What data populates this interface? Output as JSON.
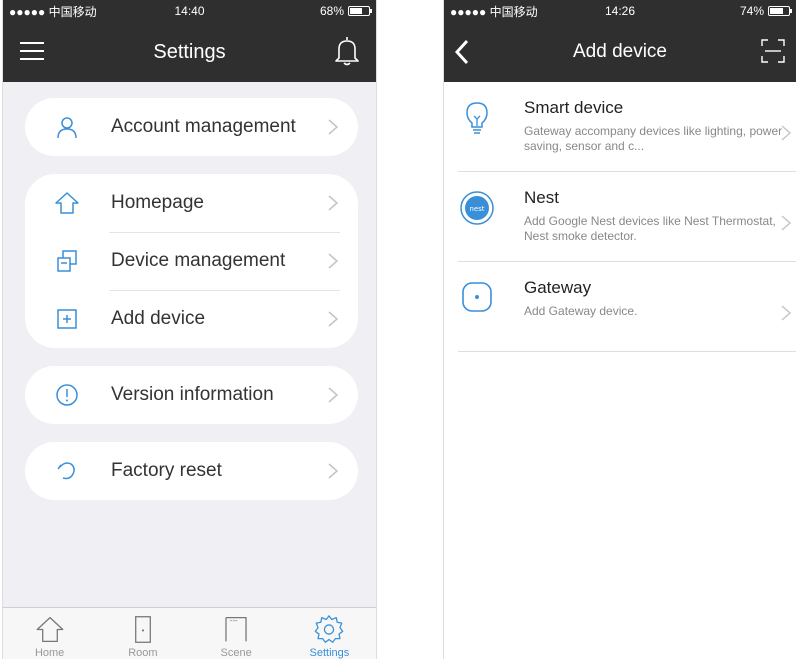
{
  "left": {
    "status": {
      "carrier": "●●●●● 中国移动",
      "time": "14:40",
      "battery": "68%",
      "battery_level": 0.68
    },
    "title": "Settings",
    "groups": [
      [
        {
          "label": "Account management",
          "icon": "person-icon"
        }
      ],
      [
        {
          "label": "Homepage",
          "icon": "house-icon"
        },
        {
          "label": "Device management",
          "icon": "devices-icon"
        },
        {
          "label": "Add device",
          "icon": "plus-box-icon"
        }
      ],
      [
        {
          "label": "Version information",
          "icon": "info-icon"
        }
      ],
      [
        {
          "label": "Factory reset",
          "icon": "reset-icon"
        }
      ]
    ],
    "tabs": [
      {
        "label": "Home",
        "icon": "house-icon",
        "active": false
      },
      {
        "label": "Room",
        "icon": "door-icon",
        "active": false
      },
      {
        "label": "Scene",
        "icon": "scene-icon",
        "active": false
      },
      {
        "label": "Settings",
        "icon": "gear-icon",
        "active": true
      }
    ]
  },
  "right": {
    "status": {
      "carrier": "●●●●● 中国移动",
      "time": "14:26",
      "battery": "74%",
      "battery_level": 0.74
    },
    "title": "Add device",
    "devices": [
      {
        "name": "Smart device",
        "desc": "Gateway accompany devices like lighting, power saving, sensor and c...",
        "icon": "bulb-icon"
      },
      {
        "name": "Nest",
        "desc": "Add Google Nest devices like Nest Thermostat, Nest smoke detector.",
        "icon": "nest-icon"
      },
      {
        "name": "Gateway",
        "desc": "Add Gateway device.",
        "icon": "gateway-icon"
      }
    ]
  },
  "colors": {
    "dark_bar": "#2f2f2f",
    "accent": "#3a8fd9",
    "background": "#efeff4"
  }
}
